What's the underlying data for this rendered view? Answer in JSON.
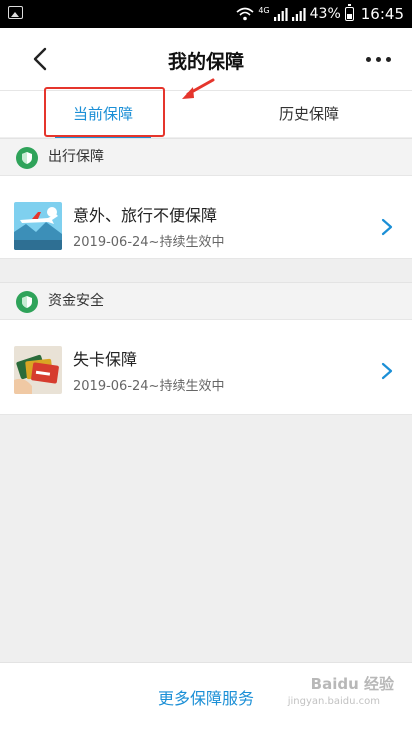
{
  "status_bar": {
    "network": "4G",
    "battery": "43%",
    "time": "16:45"
  },
  "header": {
    "title": "我的保障",
    "back_icon": "chevron-left-icon",
    "more_icon": "more-dots-icon"
  },
  "tabs": [
    {
      "label": "当前保障",
      "active": true
    },
    {
      "label": "历史保障",
      "active": false
    }
  ],
  "sections": [
    {
      "title": "出行保障",
      "icon": "shield-icon",
      "items": [
        {
          "name": "意外、旅行不便保障",
          "date": "2019-06-24~持续生效中",
          "thumb_icon": "airplane-thumbnail"
        }
      ]
    },
    {
      "title": "资金安全",
      "icon": "shield-icon",
      "items": [
        {
          "name": "失卡保障",
          "date": "2019-06-24~持续生效中",
          "thumb_icon": "bank-cards-thumbnail"
        }
      ]
    }
  ],
  "footer": {
    "more_service": "更多保障服务"
  },
  "watermark": {
    "text": "Baidu 经验",
    "sub": "jingyan.baidu.com"
  },
  "colors": {
    "accent": "#1b8fd6",
    "shield": "#2fa35a",
    "annotation": "#e5352c"
  }
}
